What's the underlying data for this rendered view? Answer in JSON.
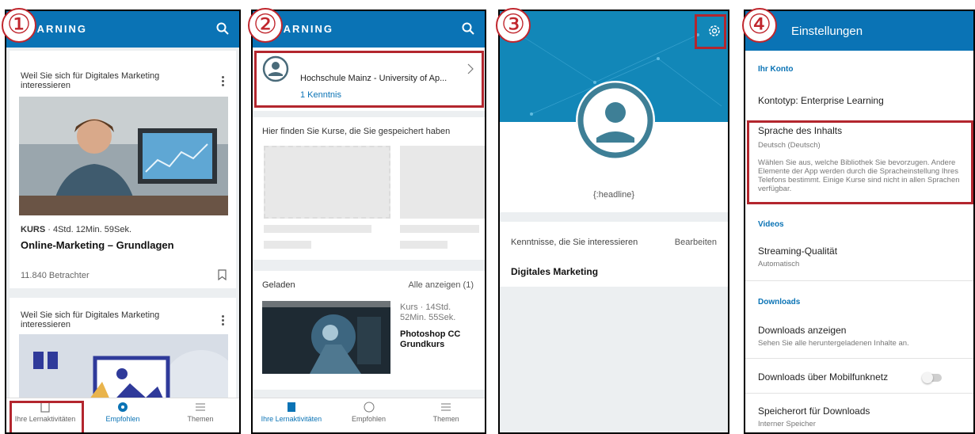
{
  "step_numbers": [
    "①",
    "②",
    "③",
    "④"
  ],
  "colors": {
    "brand_blue": "#0a73b5",
    "highlight_red": "#b3262e"
  },
  "screen1": {
    "brand": "EARNING",
    "cards": [
      {
        "reason": "Weil Sie sich für Digitales Marketing interessieren",
        "meta_type": "KURS",
        "meta_duration": " · 4Std. 12Min. 59Sek.",
        "title": "Online-Marketing – Grundlagen",
        "viewers": "11.840 Betrachter"
      },
      {
        "reason": "Weil Sie sich für Digitales Marketing interessieren"
      }
    ],
    "nav": [
      "Ihre Lernaktivitäten",
      "Empfohlen",
      "Themen"
    ],
    "active_tab": "Empfohlen"
  },
  "screen2": {
    "brand": "EARNING",
    "org_name": "Hochschule Mainz - University of Ap...",
    "skills": "1 Kenntnis",
    "saved_heading": "Hier finden Sie Kurse, die Sie gespeichert haben",
    "loaded_label": "Geladen",
    "show_all": "Alle anzeigen (1)",
    "course_meta": "Kurs · 14Std. 52Min. 55Sek.",
    "course_title": "Photoshop CC Grundkurs",
    "nav": [
      "Ihre Lernaktivitäten",
      "Empfohlen",
      "Themen"
    ],
    "active_tab": "Ihre Lernaktivitäten"
  },
  "screen3": {
    "headline": "{:headline}",
    "skills_label": "Kenntnisse, die Sie interessieren",
    "edit": "Bearbeiten",
    "skill": "Digitales Marketing"
  },
  "screen4": {
    "title": "Einstellungen",
    "account_section": "Ihr Konto",
    "account_type": "Kontotyp: Enterprise Learning",
    "content_lang_title": "Sprache des Inhalts",
    "content_lang_value": "Deutsch (Deutsch)",
    "content_lang_desc": "Wählen Sie aus, welche Bibliothek Sie bevorzugen. Andere Elemente der App werden durch die Spracheinstellung Ihres Telefons bestimmt. Einige Kurse sind nicht in allen Sprachen verfügbar.",
    "videos_section": "Videos",
    "streaming_title": "Streaming-Qualität",
    "streaming_value": "Automatisch",
    "downloads_section": "Downloads",
    "show_downloads_title": "Downloads anzeigen",
    "show_downloads_desc": "Sehen Sie alle heruntergeladenen Inhalte an.",
    "mobile_downloads": "Downloads über Mobilfunknetz",
    "mobile_downloads_on": false,
    "storage_title": "Speicherort für Downloads",
    "storage_value": "Interner Speicher"
  }
}
